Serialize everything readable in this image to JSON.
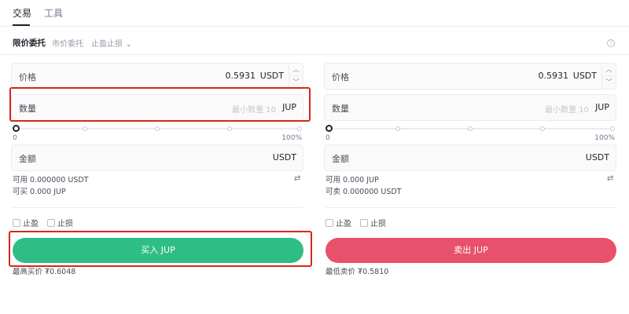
{
  "top_tabs": [
    {
      "label": "交易",
      "active": true
    },
    {
      "label": "工具",
      "active": false
    }
  ],
  "order_types": [
    {
      "label": "限价委托",
      "active": true
    },
    {
      "label": "市价委托",
      "active": false
    },
    {
      "label": "止盈止损",
      "active": false,
      "dropdown": true
    }
  ],
  "help_icon": "?",
  "buy_panel": {
    "price_label": "价格",
    "price_value": "0.5931",
    "price_unit": "USDT",
    "amount_label": "数量",
    "amount_placeholder": "最小数量 10",
    "amount_unit": "JUP",
    "slider": {
      "value_percent": 0,
      "min_label": "0",
      "max_label": "100%",
      "ticks": [
        0,
        25,
        50,
        75,
        100
      ]
    },
    "total_label": "金额",
    "total_unit": "USDT",
    "available": "可用 0.000000 USDT",
    "can_buy": "可买 0.000 JUP",
    "take_profit_label": "止盈",
    "stop_loss_label": "止损",
    "button_label": "买入 JUP",
    "best_price": "最高买价 ₮0.6048"
  },
  "sell_panel": {
    "price_label": "价格",
    "price_value": "0.5931",
    "price_unit": "USDT",
    "amount_label": "数量",
    "amount_placeholder": "最小数量 10",
    "amount_unit": "JUP",
    "slider": {
      "value_percent": 0,
      "min_label": "0",
      "max_label": "100%",
      "ticks": [
        0,
        25,
        50,
        75,
        100
      ]
    },
    "total_label": "金额",
    "total_unit": "USDT",
    "available": "可用 0.000 JUP",
    "can_sell": "可卖 0.000000 USDT",
    "take_profit_label": "止盈",
    "stop_loss_label": "止损",
    "button_label": "卖出 JUP",
    "best_price": "最低卖价 ₮0.5810"
  },
  "colors": {
    "buy": "#2ebd85",
    "sell": "#e8506c",
    "annotation": "#d9251c"
  },
  "icons": {
    "up": "chevron-up-icon",
    "down": "chevron-down-icon",
    "swap": "swap-icon",
    "help": "help-icon"
  }
}
